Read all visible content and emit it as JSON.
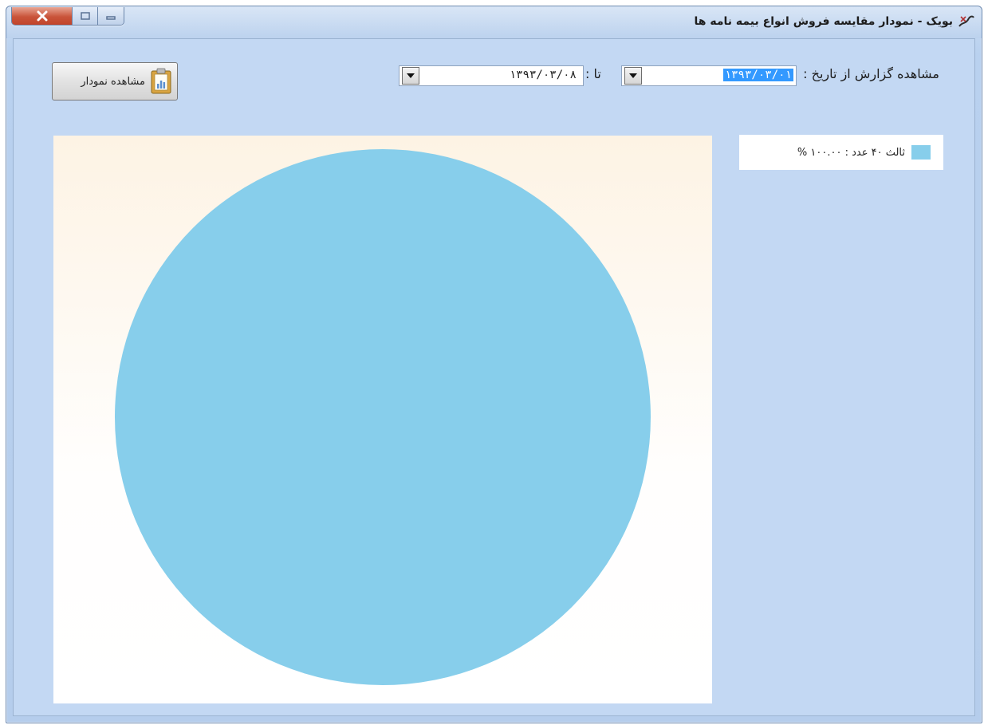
{
  "window": {
    "title": "بویک - نمودار مقایسه فروش انواع بیمه نامه ها"
  },
  "toolbar": {
    "view_chart_label": "مشاهده نمودار",
    "report_from_label": "مشاهده گزارش از تاریخ :",
    "from_date": "۱۳۹۳/۰۳/۰۱",
    "to_label": "تا :",
    "to_date": "۱۳۹۳/۰۳/۰۸"
  },
  "legend": {
    "items": [
      {
        "label": "ثالث ۴۰ عدد : ۱۰۰.۰۰ %",
        "color": "#87ceeb"
      }
    ]
  },
  "chart_data": {
    "type": "pie",
    "categories": [
      "ثالث"
    ],
    "values": [
      40
    ],
    "percentages": [
      100.0
    ],
    "colors": [
      "#87ceeb"
    ]
  }
}
